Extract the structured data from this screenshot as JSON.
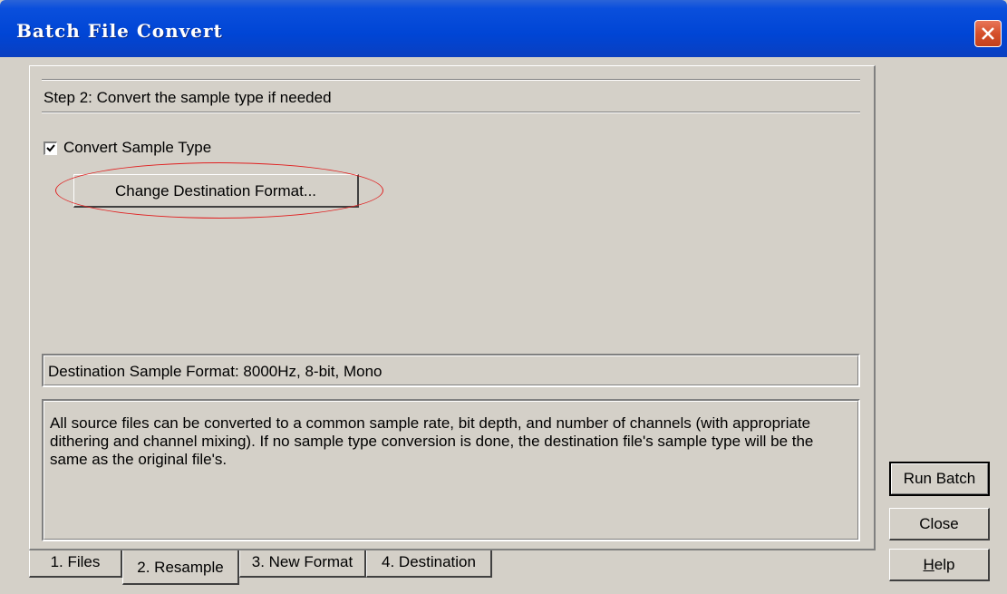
{
  "window": {
    "title": "Batch File Convert"
  },
  "step": {
    "label": "Step 2:  Convert the sample type if needed"
  },
  "convert_sample_type": {
    "label": "Convert Sample Type",
    "checked": true
  },
  "change_format_button": {
    "label": "Change Destination Format..."
  },
  "destination_format": {
    "text": "Destination Sample Format:  8000Hz, 8-bit, Mono"
  },
  "description": {
    "text": "All source files can be converted to a common sample rate, bit depth, and number of channels (with appropriate dithering and channel mixing).  If no sample type conversion is done, the destination file's sample type will be the same as the original file's."
  },
  "tabs": [
    {
      "label": "1. Files",
      "selected": false
    },
    {
      "label": "2. Resample",
      "selected": true
    },
    {
      "label": "3. New Format",
      "selected": false
    },
    {
      "label": "4. Destination",
      "selected": false
    }
  ],
  "buttons": {
    "run_batch": "Run Batch",
    "close": "Close",
    "help_prefix": "H",
    "help_rest": "elp"
  },
  "colors": {
    "titlebar": "#0045d5",
    "dialog_face": "#d4d0c8",
    "annotation": "#e02020",
    "close_button": "#d5502c"
  }
}
